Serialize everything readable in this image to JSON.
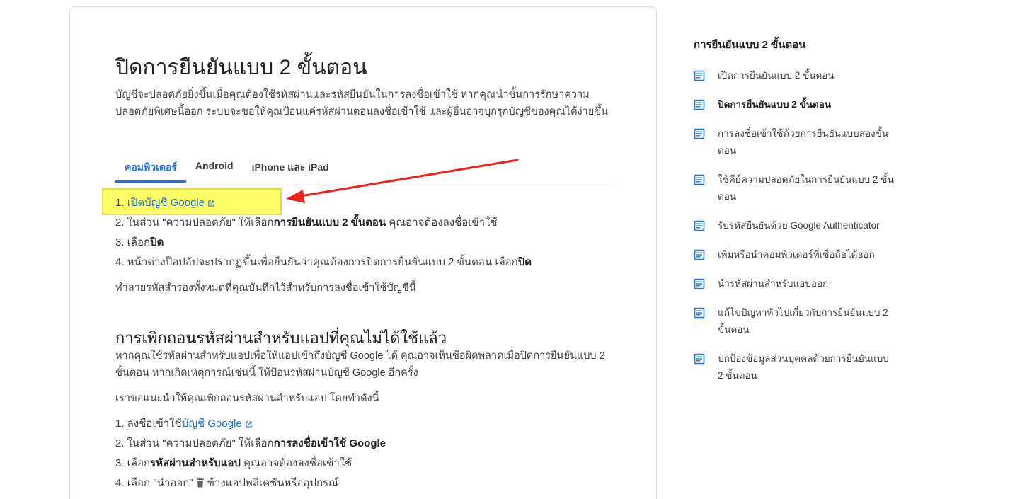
{
  "article": {
    "title": "ปิดการยืนยันแบบ 2 ขั้นตอน",
    "intro": "บัญชีจะปลอดภัยยิ่งขึ้นเมื่อคุณต้องใช้รหัสผ่านและรหัสยืนยันในการลงชื่อเข้าใช้ หากคุณนำชั้นการรักษาความปลอดภัยพิเศษนี้ออก ระบบจะขอให้คุณป้อนแค่รหัสผ่านตอนลงชื่อเข้าใช้ และผู้อื่นอาจบุกรุกบัญชีของคุณได้ง่ายขึ้น",
    "tabs": [
      {
        "label": "คอมพิวเตอร์",
        "active": true
      },
      {
        "label": "Android",
        "active": false
      },
      {
        "label": "iPhone และ iPad",
        "active": false
      }
    ],
    "steps": {
      "s1_prefix": "1. ",
      "s1_link": "เปิดบัญชี Google",
      "s2_prefix": "2. ในส่วน \"ความปลอดภัย\" ให้เลือก",
      "s2_bold": "การยืนยันแบบ 2 ขั้นตอน",
      "s2_suffix": " คุณอาจต้องลงชื่อเข้าใช้",
      "s3_prefix": "3. เลือก",
      "s3_bold": "ปิด",
      "s4_prefix": "4. หน้าต่างป๊อปอัปจะปรากฏขึ้นเพื่อยืนยันว่าคุณต้องการปิดการยืนยันแบบ 2 ขั้นตอน เลือก",
      "s4_bold": "ปิด"
    },
    "backup_note": "ทำลายรหัสสำรองทั้งหมดที่คุณบันทึกไว้สำหรับการลงชื่อเข้าใช้บัญชีนี้",
    "section2": {
      "heading": "การเพิกถอนรหัสผ่านสำหรับแอปที่คุณไม่ได้ใช้แล้ว",
      "para1": "หากคุณใช้รหัสผ่านสำหรับแอปเพื่อให้แอปเข้าถึงบัญชี Google ได้ คุณอาจเห็นข้อผิดพลาดเมื่อปิดการยืนยันแบบ 2 ขั้นตอน หากเกิดเหตุการณ์เช่นนี้ ให้ป้อนรหัสผ่านบัญชี Google อีกครั้ง",
      "para2": "เราขอแนะนำให้คุณเพิกถอนรหัสผ่านสำหรับแอป โดยทำดังนี้",
      "steps": {
        "s1_prefix": "1. ลงชื่อเข้าใช้",
        "s1_link": "บัญชี Google",
        "s2_prefix": "2. ในส่วน \"ความปลอดภัย\" ให้เลือก",
        "s2_bold": "การลงชื่อเข้าใช้ Google",
        "s3_prefix": "3. เลือก",
        "s3_bold": "รหัสผ่านสำหรับแอป",
        "s3_suffix": " คุณอาจต้องลงชื่อเข้าใช้",
        "s4_prefix": "4. เลือก \"นำออก\"",
        "s4_suffix": "ข้างแอปพลิเคชันหรืออุปกรณ์"
      }
    }
  },
  "toc": {
    "title": "การยืนยันแบบ 2 ขั้นตอน",
    "items": [
      {
        "label": "เปิดการยืนยันแบบ 2 ขั้นตอน",
        "current": false
      },
      {
        "label": "ปิดการยืนยันแบบ 2 ขั้นตอน",
        "current": true
      },
      {
        "label": "การลงชื่อเข้าใช้ด้วยการยืนยันแบบสองขั้นตอน",
        "current": false
      },
      {
        "label": "ใช้คีย์ความปลอดภัยในการยืนยันแบบ 2 ขั้นตอน",
        "current": false
      },
      {
        "label": "รับรหัสยืนยันด้วย Google Authenticator",
        "current": false
      },
      {
        "label": "เพิ่มหรือนำคอมพิวเตอร์ที่เชื่อถือได้ออก",
        "current": false
      },
      {
        "label": "นำรหัสผ่านสำหรับแอปออก",
        "current": false
      },
      {
        "label": "แก้ไขปัญหาทั่วไปเกี่ยวกับการยืนยันแบบ 2 ขั้นตอน",
        "current": false
      },
      {
        "label": "ปกป้องข้อมูลส่วนบุคคลด้วยการยืนยันแบบ 2 ขั้นตอน",
        "current": false
      }
    ]
  },
  "colors": {
    "link": "#1a73e8",
    "highlight": "#ffff66",
    "arrow": "#e8231b"
  },
  "icons": [
    "external-link-icon",
    "trash-icon",
    "document-icon"
  ]
}
